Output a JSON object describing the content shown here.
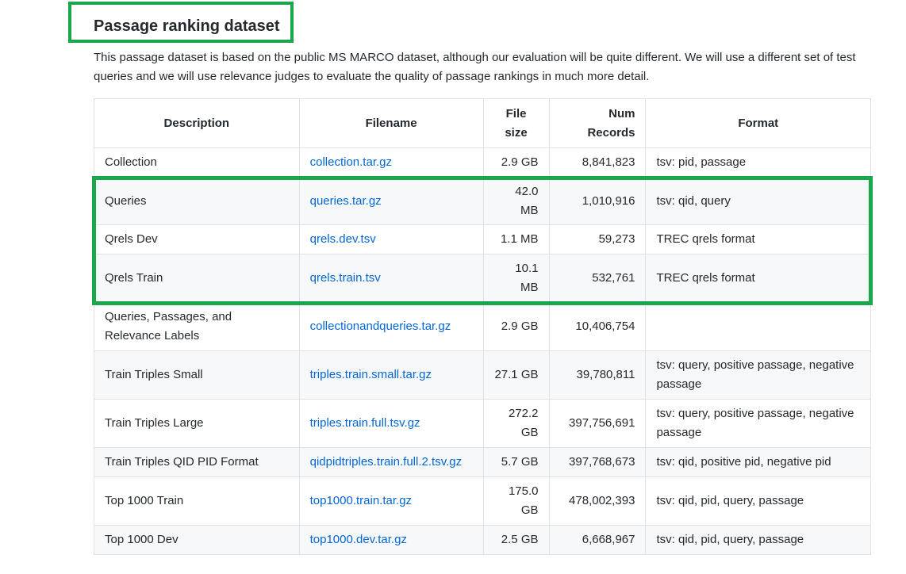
{
  "section": {
    "title": "Passage ranking dataset",
    "description": "This passage dataset is based on the public MS MARCO dataset, although our evaluation will be quite different. We will use a different set of test queries and we will use relevance judges to evaluate the quality of passage rankings in much more detail."
  },
  "table": {
    "headers": {
      "description": "Description",
      "filename": "Filename",
      "file_size": "File size",
      "num_records_line1": "Num",
      "num_records_line2": "Records",
      "format": "Format"
    },
    "rows": [
      {
        "description": "Collection",
        "filename": "collection.tar.gz",
        "size_a": "2.9 GB",
        "size_b": "",
        "records": "8,841,823",
        "format": "tsv: pid, passage"
      },
      {
        "description": "Queries",
        "filename": "queries.tar.gz",
        "size_a": "42.0",
        "size_b": "MB",
        "records": "1,010,916",
        "format": "tsv: qid, query"
      },
      {
        "description": "Qrels Dev",
        "filename": "qrels.dev.tsv",
        "size_a": "1.1 MB",
        "size_b": "",
        "records": "59,273",
        "format": "TREC qrels format"
      },
      {
        "description": "Qrels Train",
        "filename": "qrels.train.tsv",
        "size_a": "10.1",
        "size_b": "MB",
        "records": "532,761",
        "format": "TREC qrels format"
      },
      {
        "description": "Queries, Passages, and Relevance Labels",
        "filename": "collectionandqueries.tar.gz",
        "size_a": "2.9 GB",
        "size_b": "",
        "records": "10,406,754",
        "format": ""
      },
      {
        "description": "Train Triples Small",
        "filename": "triples.train.small.tar.gz",
        "size_a": "27.1 GB",
        "size_b": "",
        "records": "39,780,811",
        "format": "tsv: query, positive passage, negative passage"
      },
      {
        "description": "Train Triples Large",
        "filename": "triples.train.full.tsv.gz",
        "size_a": "272.2",
        "size_b": "GB",
        "records": "397,756,691",
        "format": "tsv: query, positive passage, negative passage"
      },
      {
        "description": "Train Triples QID PID Format",
        "filename": "qidpidtriples.train.full.2.tsv.gz",
        "size_a": "5.7 GB",
        "size_b": "",
        "records": "397,768,673",
        "format": "tsv: qid, positive pid, negative pid"
      },
      {
        "description": "Top 1000 Train",
        "filename": "top1000.train.tar.gz",
        "size_a": "175.0",
        "size_b": "GB",
        "records": "478,002,393",
        "format": "tsv: qid, pid, query, passage"
      },
      {
        "description": "Top 1000 Dev",
        "filename": "top1000.dev.tar.gz",
        "size_a": "2.5 GB",
        "size_b": "",
        "records": "6,668,967",
        "format": "tsv: qid, pid, query, passage"
      }
    ]
  },
  "colors": {
    "highlight": "#1aa64a",
    "link": "#0366d6",
    "stripe": "#f6f8fa",
    "border": "#dfe2e5"
  }
}
